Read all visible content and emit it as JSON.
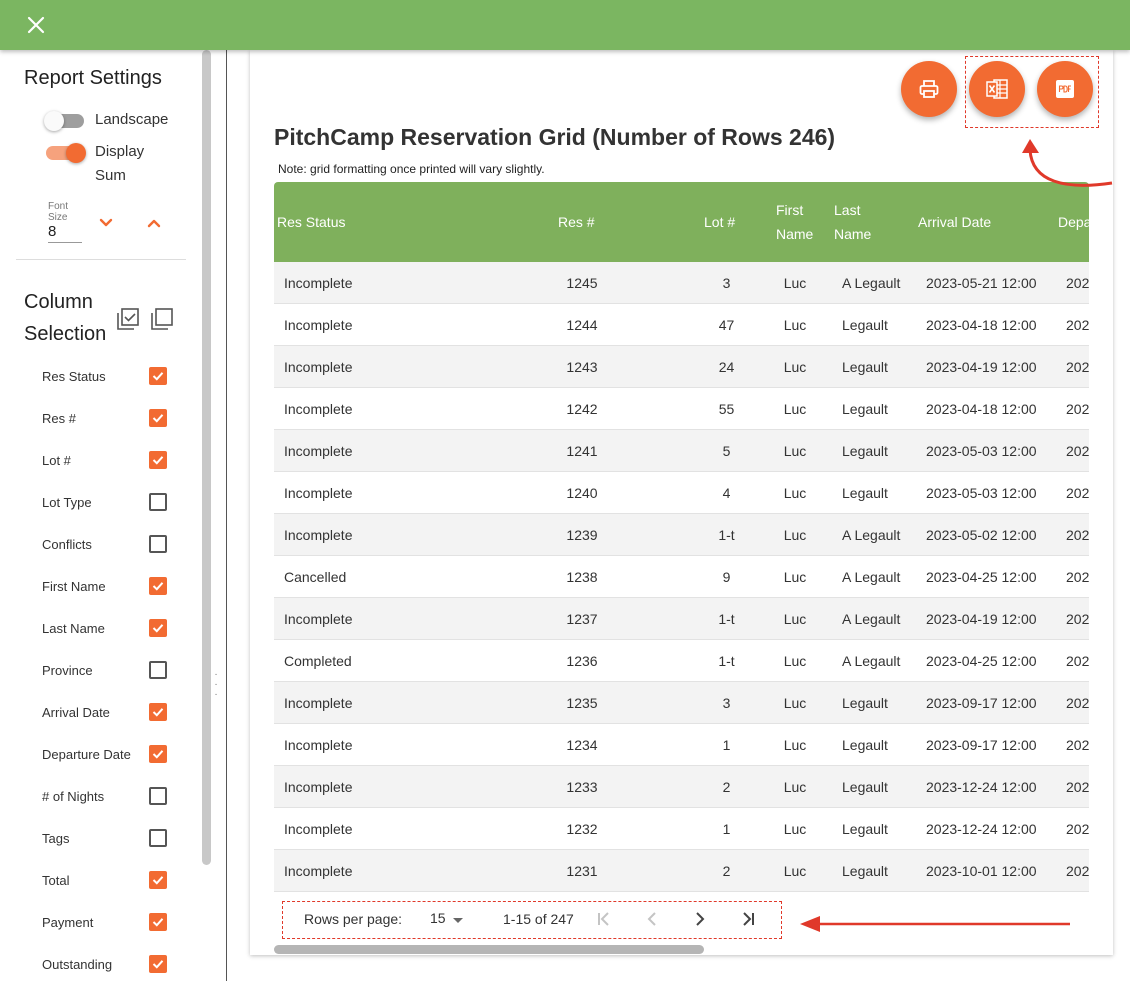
{
  "icons": {
    "close": "close-icon",
    "print": "print-icon",
    "excel": "excel-icon",
    "pdf": "pdf-icon",
    "font_down": "chevron-down-icon",
    "font_up": "chevron-up-icon",
    "select_all": "select-all-icon",
    "deselect_all": "deselect-all-icon",
    "first_page": "first-page-icon",
    "prev_page": "chevron-left-icon",
    "next_page": "chevron-right-icon",
    "last_page": "last-page-icon",
    "dropdown": "caret-down-icon"
  },
  "colors": {
    "header_bar": "#7bb661",
    "accent": "#f26b32",
    "grid_header": "#7fb05c",
    "annotation": "#e0392a"
  },
  "settings": {
    "title": "Report Settings",
    "landscape": {
      "label": "Landscape",
      "on": false
    },
    "display_sum": {
      "label": "Display Sum",
      "on": true
    },
    "font_size": {
      "label": "Font Size",
      "value": "8"
    }
  },
  "column_selection": {
    "title": "Column Selection",
    "items": [
      {
        "label": "Res Status",
        "checked": true
      },
      {
        "label": "Res #",
        "checked": true
      },
      {
        "label": "Lot #",
        "checked": true
      },
      {
        "label": "Lot Type",
        "checked": false
      },
      {
        "label": "Conflicts",
        "checked": false
      },
      {
        "label": "First Name",
        "checked": true
      },
      {
        "label": "Last Name",
        "checked": true
      },
      {
        "label": "Province",
        "checked": false
      },
      {
        "label": "Arrival Date",
        "checked": true
      },
      {
        "label": "Departure Date",
        "checked": true
      },
      {
        "label": "# of Nights",
        "checked": false
      },
      {
        "label": "Tags",
        "checked": false
      },
      {
        "label": "Total",
        "checked": true
      },
      {
        "label": "Payment",
        "checked": true
      },
      {
        "label": "Outstanding",
        "checked": true
      }
    ]
  },
  "report": {
    "title": "PitchCamp Reservation Grid (Number of Rows 246)",
    "note": "Note: grid formatting once printed will vary slightly.",
    "columns": [
      "Res Status",
      "Res #",
      "Lot #",
      "First Name",
      "Last Name",
      "Arrival Date",
      "Depa"
    ],
    "rows": [
      [
        "Incomplete",
        "1245",
        "3",
        "Luc",
        "A Legault",
        "2023-05-21 12:00",
        "202"
      ],
      [
        "Incomplete",
        "1244",
        "47",
        "Luc",
        "Legault",
        "2023-04-18 12:00",
        "202"
      ],
      [
        "Incomplete",
        "1243",
        "24",
        "Luc",
        "Legault",
        "2023-04-19 12:00",
        "202"
      ],
      [
        "Incomplete",
        "1242",
        "55",
        "Luc",
        "Legault",
        "2023-04-18 12:00",
        "202"
      ],
      [
        "Incomplete",
        "1241",
        "5",
        "Luc",
        "Legault",
        "2023-05-03 12:00",
        "202"
      ],
      [
        "Incomplete",
        "1240",
        "4",
        "Luc",
        "Legault",
        "2023-05-03 12:00",
        "202"
      ],
      [
        "Incomplete",
        "1239",
        "1-t",
        "Luc",
        "A Legault",
        "2023-05-02 12:00",
        "202"
      ],
      [
        "Cancelled",
        "1238",
        "9",
        "Luc",
        "A Legault",
        "2023-04-25 12:00",
        "202"
      ],
      [
        "Incomplete",
        "1237",
        "1-t",
        "Luc",
        "A Legault",
        "2023-04-19 12:00",
        "202"
      ],
      [
        "Completed",
        "1236",
        "1-t",
        "Luc",
        "A Legault",
        "2023-04-25 12:00",
        "202"
      ],
      [
        "Incomplete",
        "1235",
        "3",
        "Luc",
        "Legault",
        "2023-09-17 12:00",
        "202"
      ],
      [
        "Incomplete",
        "1234",
        "1",
        "Luc",
        "Legault",
        "2023-09-17 12:00",
        "202"
      ],
      [
        "Incomplete",
        "1233",
        "2",
        "Luc",
        "Legault",
        "2023-12-24 12:00",
        "202"
      ],
      [
        "Incomplete",
        "1232",
        "1",
        "Luc",
        "Legault",
        "2023-12-24 12:00",
        "202"
      ],
      [
        "Incomplete",
        "1231",
        "2",
        "Luc",
        "Legault",
        "2023-10-01 12:00",
        "202"
      ]
    ]
  },
  "pagination": {
    "rows_per_page_label": "Rows per page:",
    "rows_per_page_value": "15",
    "range": "1-15 of 247"
  }
}
